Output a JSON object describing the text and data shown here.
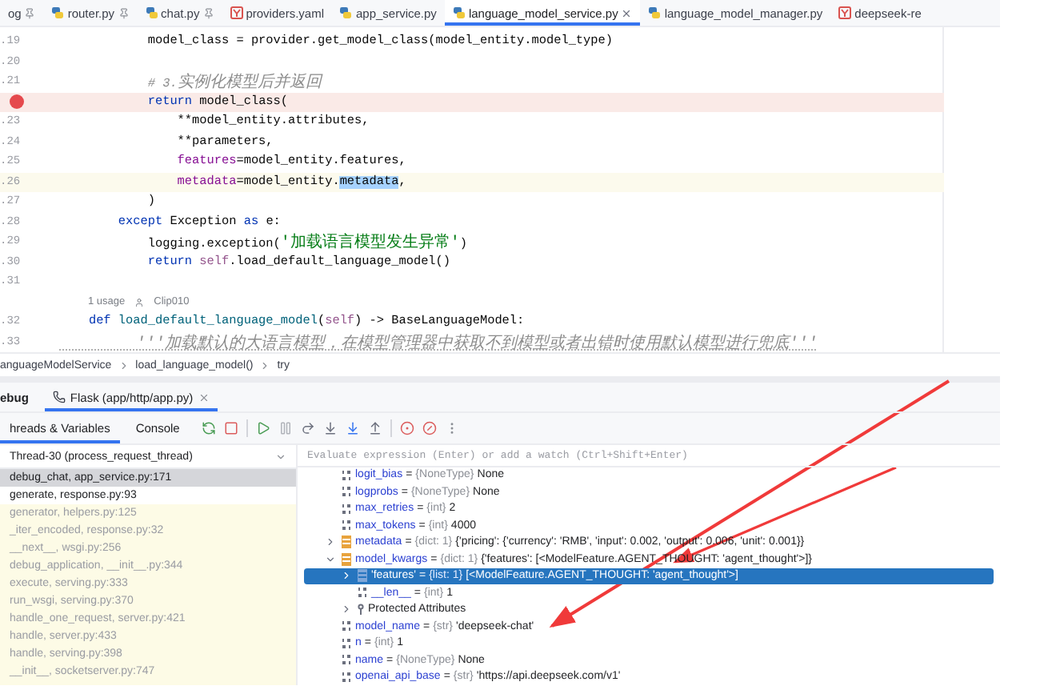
{
  "tabs": [
    {
      "label": "og",
      "kind": "plain",
      "pinned": true,
      "selected": false,
      "closable": false
    },
    {
      "label": "router.py",
      "kind": "python",
      "pinned": true,
      "selected": false,
      "closable": false
    },
    {
      "label": "chat.py",
      "kind": "python",
      "pinned": true,
      "selected": false,
      "closable": false
    },
    {
      "label": "providers.yaml",
      "kind": "yaml",
      "pinned": false,
      "selected": false,
      "closable": false
    },
    {
      "label": "app_service.py",
      "kind": "python",
      "pinned": false,
      "selected": false,
      "closable": false
    },
    {
      "label": "language_model_service.py",
      "kind": "python",
      "pinned": false,
      "selected": true,
      "closable": true
    },
    {
      "label": "language_model_manager.py",
      "kind": "python",
      "pinned": false,
      "selected": false,
      "closable": false
    },
    {
      "label": "deepseek-re",
      "kind": "yaml",
      "pinned": false,
      "selected": false,
      "closable": false
    }
  ],
  "editor": {
    "lines": [
      {
        "kind": "code",
        "number": ".19",
        "breakpoint": false,
        "caret": false,
        "tokens": [
          {
            "t": "            model_class = provider.get_model_class(model_entity.model_type)",
            "kind": "plain"
          }
        ]
      },
      {
        "kind": "code",
        "number": ".20",
        "breakpoint": false,
        "caret": false
      },
      {
        "kind": "code",
        "number": ".21",
        "breakpoint": false,
        "caret": false,
        "tokens": [
          {
            "t": "            # 3.",
            "kind": "comment"
          },
          {
            "t": "实例化模型后并返回",
            "kind": "comment-cjk"
          }
        ]
      },
      {
        "kind": "code",
        "breakpoint": true,
        "caret": false,
        "tokens": [
          {
            "t": "            return",
            "kind": "keyword"
          },
          {
            "t": " model_class(",
            "kind": "plain"
          }
        ]
      },
      {
        "kind": "code",
        "number": ".23",
        "breakpoint": false,
        "caret": false,
        "tokens": [
          {
            "t": "                **model_entity.attributes,",
            "kind": "plain"
          }
        ]
      },
      {
        "kind": "code",
        "number": ".24",
        "breakpoint": false,
        "caret": false,
        "tokens": [
          {
            "t": "                **parameters,",
            "kind": "plain"
          }
        ]
      },
      {
        "kind": "code",
        "number": ".25",
        "breakpoint": false,
        "caret": false,
        "tokens": [
          {
            "t": "                features",
            "kind": "param"
          },
          {
            "t": "=model_entity.features,",
            "kind": "plain"
          }
        ]
      },
      {
        "kind": "code",
        "number": ".26",
        "breakpoint": false,
        "caret": true,
        "tokens": [
          {
            "t": "                metadata",
            "kind": "param"
          },
          {
            "t": "=model_entity.",
            "kind": "plain"
          },
          {
            "t": "metadata",
            "kind": "selection"
          },
          {
            "t": ",",
            "kind": "plain"
          }
        ]
      },
      {
        "kind": "code",
        "number": ".27",
        "breakpoint": false,
        "caret": false,
        "tokens": [
          {
            "t": "            )",
            "kind": "plain"
          }
        ]
      },
      {
        "kind": "code",
        "number": ".28",
        "breakpoint": false,
        "caret": false,
        "tokens": [
          {
            "t": "        except",
            "kind": "keyword"
          },
          {
            "t": " Exception ",
            "kind": "plain"
          },
          {
            "t": "as",
            "kind": "keyword"
          },
          {
            "t": " e:",
            "kind": "plain"
          }
        ]
      },
      {
        "kind": "code",
        "number": ".29",
        "breakpoint": false,
        "caret": false,
        "tokens": [
          {
            "t": "            logging.exception(",
            "kind": "plain"
          },
          {
            "t": "'加载语言模型发生异常'",
            "kind": "string-cjk"
          },
          {
            "t": ")",
            "kind": "plain"
          }
        ]
      },
      {
        "kind": "code",
        "number": ".30",
        "breakpoint": false,
        "caret": false,
        "tokens": [
          {
            "t": "            return",
            "kind": "keyword"
          },
          {
            "t": " self",
            "kind": "self"
          },
          {
            "t": ".load_default_language_model()",
            "kind": "plain"
          }
        ]
      },
      {
        "kind": "code",
        "number": ".31",
        "breakpoint": false,
        "caret": false
      },
      {
        "kind": "usage",
        "usages": "1 usage",
        "author": "Clip010"
      },
      {
        "kind": "code",
        "number": ".32",
        "breakpoint": false,
        "caret": false,
        "tokens": [
          {
            "t": "    def",
            "kind": "keyword"
          },
          {
            "t": " load_default_language_model",
            "kind": "func"
          },
          {
            "t": "(",
            "kind": "plain"
          },
          {
            "t": "self",
            "kind": "self"
          },
          {
            "t": ") -> BaseLanguageModel:",
            "kind": "plain"
          }
        ]
      },
      {
        "kind": "code",
        "number": ".33",
        "breakpoint": false,
        "caret": false,
        "tokens": [
          {
            "t": "        '''加载默认的大语言模型，在模型管理器中获取不到模型或者出错时使用默认模型进行兜底'''",
            "kind": "doc-cjk"
          }
        ]
      }
    ]
  },
  "breadcrumb": [
    "anguageModelService",
    "load_language_model()",
    "try"
  ],
  "debug": {
    "title": "ebug",
    "tabs": [
      {
        "label": "Flask (app/http/app.py)",
        "selected": true
      }
    ],
    "subtabs": [
      {
        "label": "hreads & Variables",
        "selected": true
      },
      {
        "label": "Console",
        "selected": false
      }
    ],
    "thread": "Thread-30 (process_request_thread)",
    "frames": [
      {
        "label": "debug_chat, app_service.py:171",
        "selected": true,
        "library": false
      },
      {
        "label": "generate, response.py:93",
        "selected": false,
        "library": false
      },
      {
        "label": "generator, helpers.py:125",
        "selected": false,
        "library": true
      },
      {
        "label": "_iter_encoded, response.py:32",
        "selected": false,
        "library": true
      },
      {
        "label": "__next__, wsgi.py:256",
        "selected": false,
        "library": true
      },
      {
        "label": "debug_application, __init__.py:344",
        "selected": false,
        "library": true
      },
      {
        "label": "execute, serving.py:333",
        "selected": false,
        "library": true
      },
      {
        "label": "run_wsgi, serving.py:370",
        "selected": false,
        "library": true
      },
      {
        "label": "handle_one_request, server.py:421",
        "selected": false,
        "library": true
      },
      {
        "label": "handle, server.py:433",
        "selected": false,
        "library": true
      },
      {
        "label": "handle, serving.py:398",
        "selected": false,
        "library": true
      },
      {
        "label": "__init__, socketserver.py:747",
        "selected": false,
        "library": true
      }
    ],
    "evaluate": {
      "placeholder": "Evaluate expression (Enter) or add a watch (Ctrl+Shift+Enter)"
    },
    "variables": [
      {
        "kind": "value",
        "name": "logit_bias",
        "sign": "=",
        "type": "{NoneType}",
        "value": "None",
        "selected": false
      },
      {
        "kind": "value",
        "name": "logprobs",
        "sign": "=",
        "type": "{NoneType}",
        "value": "None",
        "selected": false
      },
      {
        "kind": "value",
        "name": "max_retries",
        "sign": "=",
        "type": "{int}",
        "value": "2",
        "selected": false
      },
      {
        "kind": "value",
        "name": "max_tokens",
        "sign": "=",
        "type": "{int}",
        "value": "4000",
        "selected": false
      },
      {
        "kind": "dict",
        "name": "metadata",
        "sign": "=",
        "type": "{dict: 1}",
        "value": "{'pricing': {'currency': 'RMB', 'input': 0.002, 'output': 0.006, 'unit': 0.001}}",
        "selected": false,
        "expanded": false
      },
      {
        "kind": "dict",
        "name": "model_kwargs",
        "sign": "=",
        "type": "{dict: 1}",
        "value": "{'features': [<ModelFeature.AGENT_THOUGHT: 'agent_thought'>]}",
        "selected": false,
        "expanded": true,
        "children": [
          {
            "kind": "list",
            "name": "'features'",
            "sign": "=",
            "type": "{list: 1}",
            "value": "[<ModelFeature.AGENT_THOUGHT: 'agent_thought'>]",
            "selected": true,
            "expanded": false
          },
          {
            "kind": "value",
            "name": "__len__",
            "sign": "=",
            "type": "{int}",
            "value": "1",
            "selected": false
          },
          {
            "kind": "group",
            "name": "Protected Attributes",
            "selected": false,
            "expanded": false
          }
        ]
      },
      {
        "kind": "value",
        "name": "model_name",
        "sign": "=",
        "type": "{str}",
        "value": "'deepseek-chat'",
        "selected": false
      },
      {
        "kind": "value",
        "name": "n",
        "sign": "=",
        "type": "{int}",
        "value": "1",
        "selected": false
      },
      {
        "kind": "value",
        "name": "name",
        "sign": "=",
        "type": "{NoneType}",
        "value": "None",
        "selected": false
      },
      {
        "kind": "value",
        "name": "openai_api_base",
        "sign": "=",
        "type": "{str}",
        "value": "'https://api.deepseek.com/v1'",
        "selected": false
      }
    ]
  }
}
